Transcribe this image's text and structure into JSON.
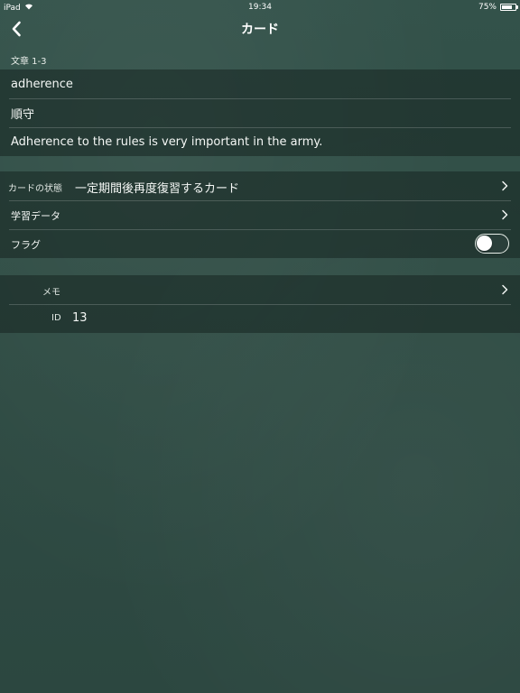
{
  "status_bar": {
    "device": "iPad",
    "time": "19:34",
    "battery": "75%",
    "battery_level": 0.75
  },
  "nav": {
    "title": "カード"
  },
  "section": {
    "header": "文章 1-3"
  },
  "card": {
    "word": "adherence",
    "meaning": "順守",
    "example": "Adherence to the rules is very important in the army."
  },
  "settings": {
    "state_label": "カードの状態",
    "state_value": "一定期間後再度復習するカード",
    "study_data_label": "学習データ",
    "flag_label": "フラグ",
    "flag_on": false
  },
  "meta": {
    "memo_label": "メモ",
    "id_label": "ID",
    "id_value": "13"
  },
  "colors": {
    "background": "#2f4c44",
    "row_overlay": "#162421"
  }
}
